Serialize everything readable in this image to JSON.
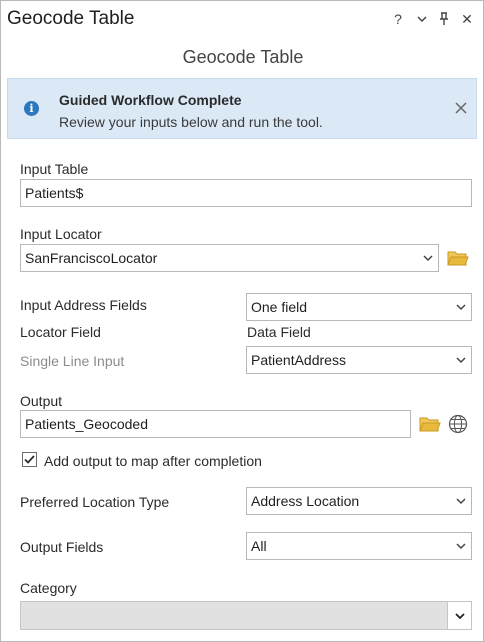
{
  "pane": {
    "title": "Geocode Table",
    "controls": {
      "help": "?",
      "menu_icon": "chevron-down-icon",
      "pin_icon": "pin-icon",
      "close": "✕"
    }
  },
  "tool": {
    "title": "Geocode Table"
  },
  "banner": {
    "title": "Guided Workflow Complete",
    "message": "Review your inputs below and run the tool.",
    "icon": "info-icon",
    "color": "#dbe9f6"
  },
  "input_table": {
    "label": "Input Table",
    "value": "Patients$"
  },
  "input_locator": {
    "label": "Input Locator",
    "value": "SanFranciscoLocator"
  },
  "address_fields": {
    "label": "Input Address Fields",
    "value": "One field",
    "locator_field_header": "Locator Field",
    "data_field_header": "Data Field",
    "row_label": "Single Line Input",
    "row_value": "PatientAddress"
  },
  "output": {
    "label": "Output",
    "value": "Patients_Geocoded"
  },
  "add_to_map": {
    "label": "Add output to map after completion",
    "checked": true
  },
  "preferred_location": {
    "label": "Preferred Location Type",
    "value": "Address Location"
  },
  "output_fields": {
    "label": "Output Fields",
    "value": "All"
  },
  "category": {
    "label": "Category",
    "value": ""
  },
  "colors": {
    "accent": "#2d77bd",
    "folder": "#e8b93a",
    "banner_bg": "#dbe9f6"
  }
}
